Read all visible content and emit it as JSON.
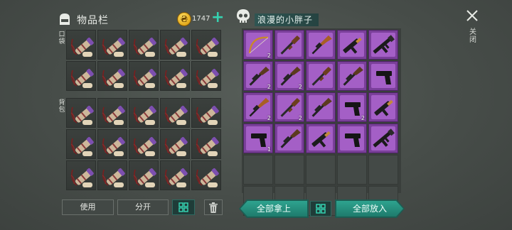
{
  "inventory": {
    "title": "物品栏",
    "gold": "1747",
    "coin_glyph": "₴",
    "add_label": "+",
    "pocket_label": "口袋",
    "backpack_label": "背包",
    "pocket_slots": [
      {
        "item": "bone-spear-pack",
        "count": ""
      },
      {
        "item": "bone-spear-pack",
        "count": ""
      },
      {
        "item": "bone-spear-pack",
        "count": ""
      },
      {
        "item": "bone-spear-pack",
        "count": ""
      },
      {
        "item": "bone-spear-pack",
        "count": ""
      },
      {
        "item": "bone-spear-pack",
        "count": ""
      },
      {
        "item": "bone-spear-pack",
        "count": ""
      },
      {
        "item": "bone-spear-pack",
        "count": ""
      },
      {
        "item": "bone-spear-pack",
        "count": ""
      },
      {
        "item": "bone-spear-pack",
        "count": ""
      }
    ],
    "backpack_slots": [
      {
        "item": "bone-spear-pack",
        "count": ""
      },
      {
        "item": "bone-spear-pack",
        "count": ""
      },
      {
        "item": "bone-spear-pack",
        "count": ""
      },
      {
        "item": "bone-spear-pack",
        "count": ""
      },
      {
        "item": "bone-spear-pack",
        "count": ""
      },
      {
        "item": "bone-spear-pack",
        "count": ""
      },
      {
        "item": "bone-spear-pack",
        "count": ""
      },
      {
        "item": "bone-spear-pack",
        "count": ""
      },
      {
        "item": "bone-spear-pack",
        "count": ""
      },
      {
        "item": "bone-spear-pack",
        "count": ""
      },
      {
        "item": "bone-spear-pack",
        "count": ""
      },
      {
        "item": "bone-spear-pack",
        "count": ""
      },
      {
        "item": "bone-spear-pack",
        "count": ""
      },
      {
        "item": "bone-spear-pack",
        "count": ""
      },
      {
        "item": "bone-spear-pack",
        "count": ""
      }
    ],
    "buttons": {
      "use": "使用",
      "split": "分开"
    }
  },
  "container": {
    "name": "浪漫的小胖子",
    "close_label": "关闭",
    "take_all": "全部拿上",
    "put_all": "全部放入",
    "slots": [
      {
        "item": "bow",
        "count": "2"
      },
      {
        "item": "shotgun",
        "count": ""
      },
      {
        "item": "hunting-rifle",
        "count": ""
      },
      {
        "item": "smg",
        "count": ""
      },
      {
        "item": "assault-rifle",
        "count": ""
      },
      {
        "item": "rifle",
        "count": "2"
      },
      {
        "item": "rifle",
        "count": "2"
      },
      {
        "item": "shotgun",
        "count": ""
      },
      {
        "item": "rifle",
        "count": ""
      },
      {
        "item": "pistol",
        "count": ""
      },
      {
        "item": "hunting-rifle",
        "count": "2"
      },
      {
        "item": "shotgun",
        "count": "2"
      },
      {
        "item": "rifle",
        "count": ""
      },
      {
        "item": "pistol",
        "count": "2"
      },
      {
        "item": "smg",
        "count": ""
      },
      {
        "item": "pistol",
        "count": "1"
      },
      {
        "item": "rifle",
        "count": ""
      },
      {
        "item": "smg",
        "count": ""
      },
      {
        "item": "pistol",
        "count": ""
      },
      {
        "item": "assault-rifle",
        "count": ""
      },
      {
        "item": "",
        "count": ""
      },
      {
        "item": "",
        "count": ""
      },
      {
        "item": "",
        "count": ""
      },
      {
        "item": "",
        "count": ""
      },
      {
        "item": "",
        "count": ""
      },
      {
        "item": "",
        "count": ""
      },
      {
        "item": "",
        "count": ""
      },
      {
        "item": "",
        "count": ""
      },
      {
        "item": "",
        "count": ""
      },
      {
        "item": "",
        "count": ""
      }
    ]
  },
  "colors": {
    "accent_teal": "#2ea38f",
    "weapon_slot_purple": "#a45fc6",
    "gold": "#e3a81a"
  }
}
